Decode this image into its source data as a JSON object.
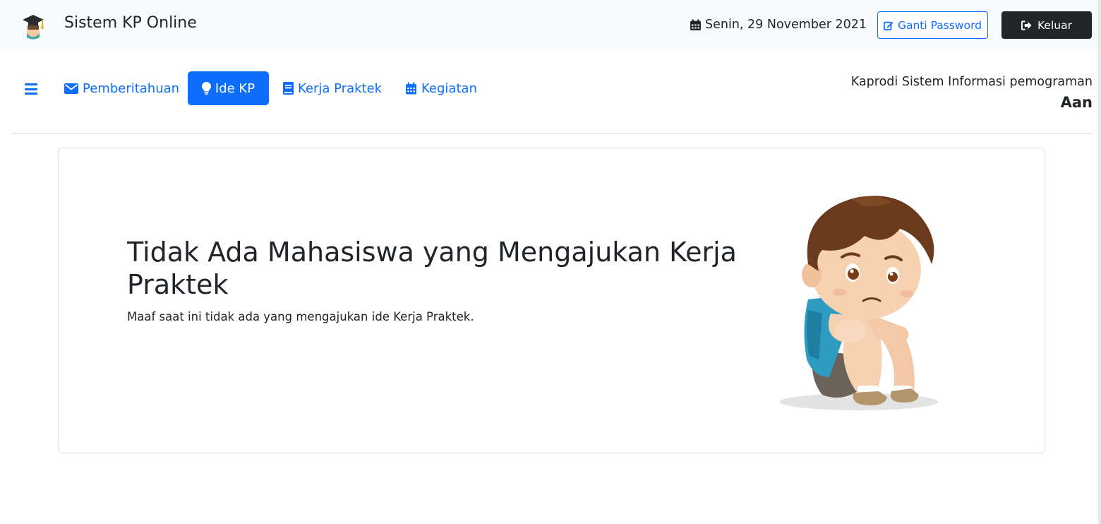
{
  "header": {
    "app_title": "Sistem KP Online",
    "logo_icon": "graduation-cap-logo",
    "date": "Senin, 29 November 2021",
    "date_icon": "calendar-icon",
    "change_password_label": "Ganti Password",
    "change_password_icon": "edit-icon",
    "logout_label": "Keluar",
    "logout_icon": "sign-out-icon"
  },
  "nav": {
    "menu_icon": "hamburger-icon",
    "items": [
      {
        "label": "Pemberitahuan",
        "icon": "envelope-icon",
        "active": false
      },
      {
        "label": "Ide KP",
        "icon": "lightbulb-icon",
        "active": true
      },
      {
        "label": "Kerja Praktek",
        "icon": "book-icon",
        "active": false
      },
      {
        "label": "Kegiatan",
        "icon": "calendar-icon",
        "active": false
      }
    ]
  },
  "user": {
    "role": "Kaprodi Sistem Informasi pemograman",
    "name": "Aan"
  },
  "empty_state": {
    "title": "Tidak Ada Mahasiswa yang Mengajukan Kerja Praktek",
    "message": "Maaf saat ini tidak ada yang mengajukan ide Kerja Praktek.",
    "illustration": "sad-boy-illustration"
  },
  "colors": {
    "primary": "#0d6efd",
    "dark": "#212529",
    "topbar_bg": "#f8f9fa"
  }
}
